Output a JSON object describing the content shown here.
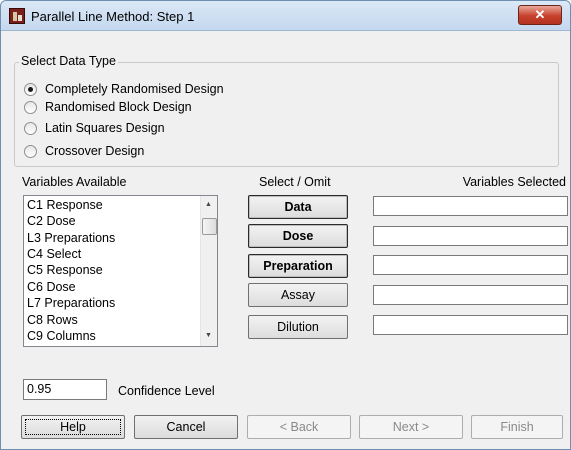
{
  "window": {
    "title": "Parallel Line Method: Step 1",
    "close_glyph": "✕",
    "icon": "app-icon"
  },
  "data_type": {
    "label": "Select Data Type",
    "options": [
      {
        "label": "Completely Randomised Design",
        "selected": true
      },
      {
        "label": "Randomised Block Design",
        "selected": false
      },
      {
        "label": "Latin Squares Design",
        "selected": false
      },
      {
        "label": "Crossover Design",
        "selected": false
      }
    ]
  },
  "variables_available": {
    "label": "Variables Available",
    "items": [
      "C1 Response",
      "C2 Dose",
      "L3 Preparations",
      "C4 Select",
      "C5 Response",
      "C6 Dose",
      "L7 Preparations",
      "C8 Rows",
      "C9 Columns"
    ]
  },
  "select_omit": {
    "label": "Select / Omit",
    "buttons": [
      "Data",
      "Dose",
      "Preparation",
      "Assay",
      "Dilution"
    ]
  },
  "variables_selected": {
    "label": "Variables Selected",
    "fields": [
      "",
      "",
      "",
      "",
      ""
    ]
  },
  "confidence": {
    "value": "0.95",
    "label": "Confidence Level"
  },
  "footer": {
    "help": "Help",
    "cancel": "Cancel",
    "back": "< Back",
    "next": "Next >",
    "finish": "Finish"
  }
}
